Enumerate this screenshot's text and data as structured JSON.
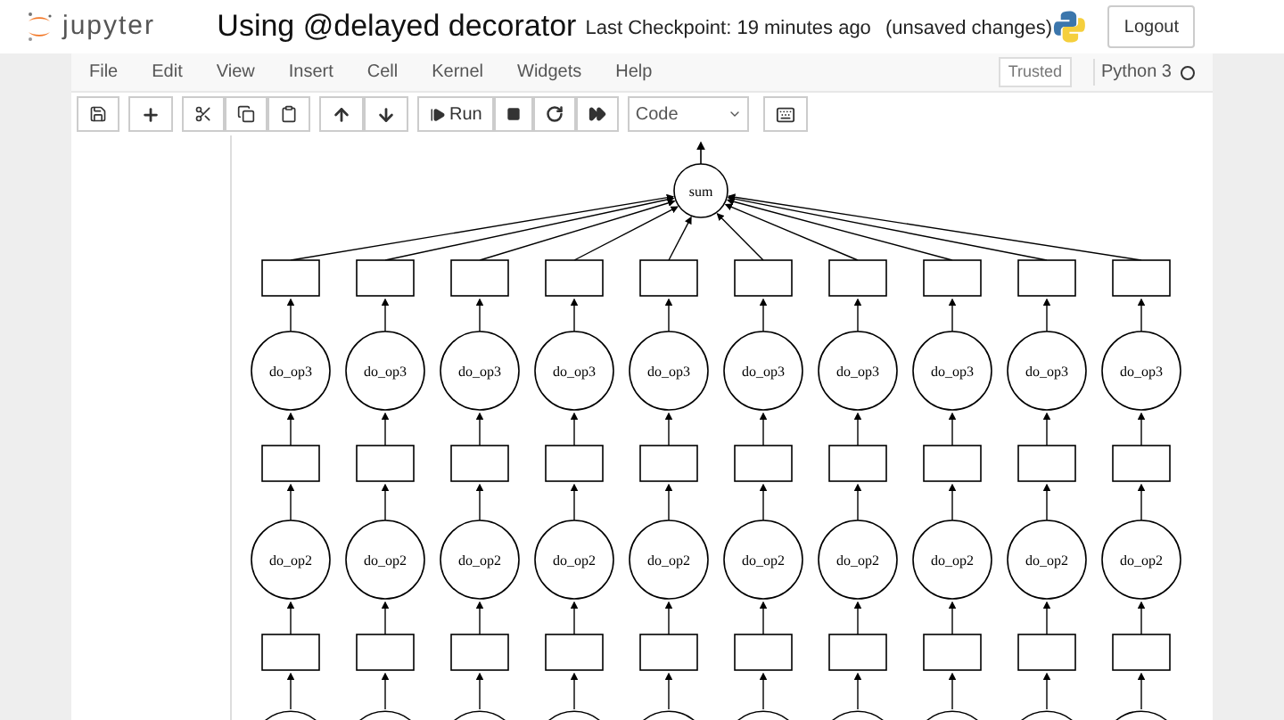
{
  "header": {
    "logo_text": "jupyter",
    "title": "Using @delayed decorator",
    "checkpoint": "Last Checkpoint: 19 minutes ago",
    "save_status": "(unsaved changes)",
    "logout": "Logout"
  },
  "menu": [
    "File",
    "Edit",
    "View",
    "Insert",
    "Cell",
    "Kernel",
    "Widgets",
    "Help"
  ],
  "trusted": "Trusted",
  "kernel": {
    "name": "Python 3",
    "busy": false
  },
  "toolbar": {
    "run": "Run",
    "cell_type": "Code"
  },
  "graph": {
    "root": "sum",
    "columns": [
      {
        "upper_op": "do_op3",
        "lower_op": "do_op2"
      },
      {
        "upper_op": "do_op3",
        "lower_op": "do_op2"
      },
      {
        "upper_op": "do_op3",
        "lower_op": "do_op2"
      },
      {
        "upper_op": "do_op3",
        "lower_op": "do_op2"
      },
      {
        "upper_op": "do_op3",
        "lower_op": "do_op2"
      },
      {
        "upper_op": "do_op3",
        "lower_op": "do_op2"
      },
      {
        "upper_op": "do_op3",
        "lower_op": "do_op2"
      },
      {
        "upper_op": "do_op3",
        "lower_op": "do_op2"
      },
      {
        "upper_op": "do_op3",
        "lower_op": "do_op2"
      },
      {
        "upper_op": "do_op3",
        "lower_op": "do_op2"
      }
    ]
  }
}
